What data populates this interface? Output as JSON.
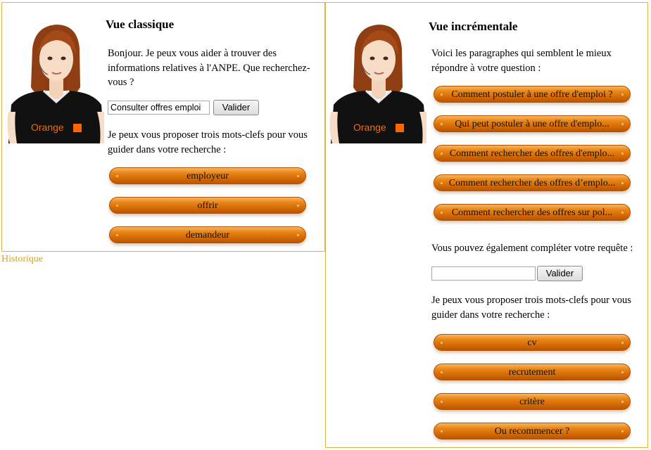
{
  "left": {
    "title": "Vue classique",
    "intro": "Bonjour. Je peux vous aider à trouver des informations relatives à l'ANPE. Que recherchez-vous ?",
    "search": {
      "value": "Consulter offres emploi",
      "button": "Valider"
    },
    "keywords_intro": "Je peux vous proposer trois mots-clefs pour vous guider dans votre recherche :",
    "keywords": [
      "employeur",
      "offrir",
      "demandeur"
    ]
  },
  "history_link": "Historique",
  "right": {
    "title": "Vue incrémentale",
    "intro": "Voici les paragraphes qui semblent le mieux répondre à votre question :",
    "answers": [
      "Comment postuler à une offre d'emploi ?",
      "Qui peut postuler à une offre d'emplo...",
      "Comment rechercher des offres d'emplo...",
      "Comment rechercher des offres d’emplo...",
      "Comment rechercher des offres sur pol..."
    ],
    "complete_intro": "Vous pouvez également compléter votre requête :",
    "search": {
      "value": "",
      "button": "Valider"
    },
    "keywords_intro": "Je peux vous proposer trois mots-clefs pour vous guider dans votre recherche :",
    "keywords": [
      "cv",
      "recrutement",
      "critère",
      "Ou recommencer ?"
    ]
  },
  "avatar": {
    "shirt_text": "Orange",
    "colors": {
      "accent": "#ff6600",
      "border": "#e0b545"
    }
  }
}
